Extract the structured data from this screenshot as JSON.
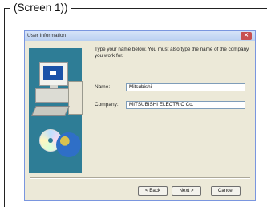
{
  "caption": "(Screen 1))",
  "dialog": {
    "title": "User Information",
    "close_symbol": "✕",
    "intro": "Type your name below. You must also type the name of the company you work for.",
    "fields": [
      {
        "label": "Name:",
        "value": "Mitsubishi"
      },
      {
        "label": "Company:",
        "value": "MITSUBISHI ELECTRIC Co."
      }
    ],
    "buttons": {
      "back": "< Back",
      "next": "Next >",
      "cancel": "Cancel"
    }
  },
  "colors": {
    "titlebar": "#b9cff1",
    "side_panel": "#2e7d96",
    "dialog_bg": "#ece9d8"
  },
  "icons": [
    "computer-illustration",
    "cd-disc-icon",
    "globe-icon",
    "close-icon"
  ]
}
